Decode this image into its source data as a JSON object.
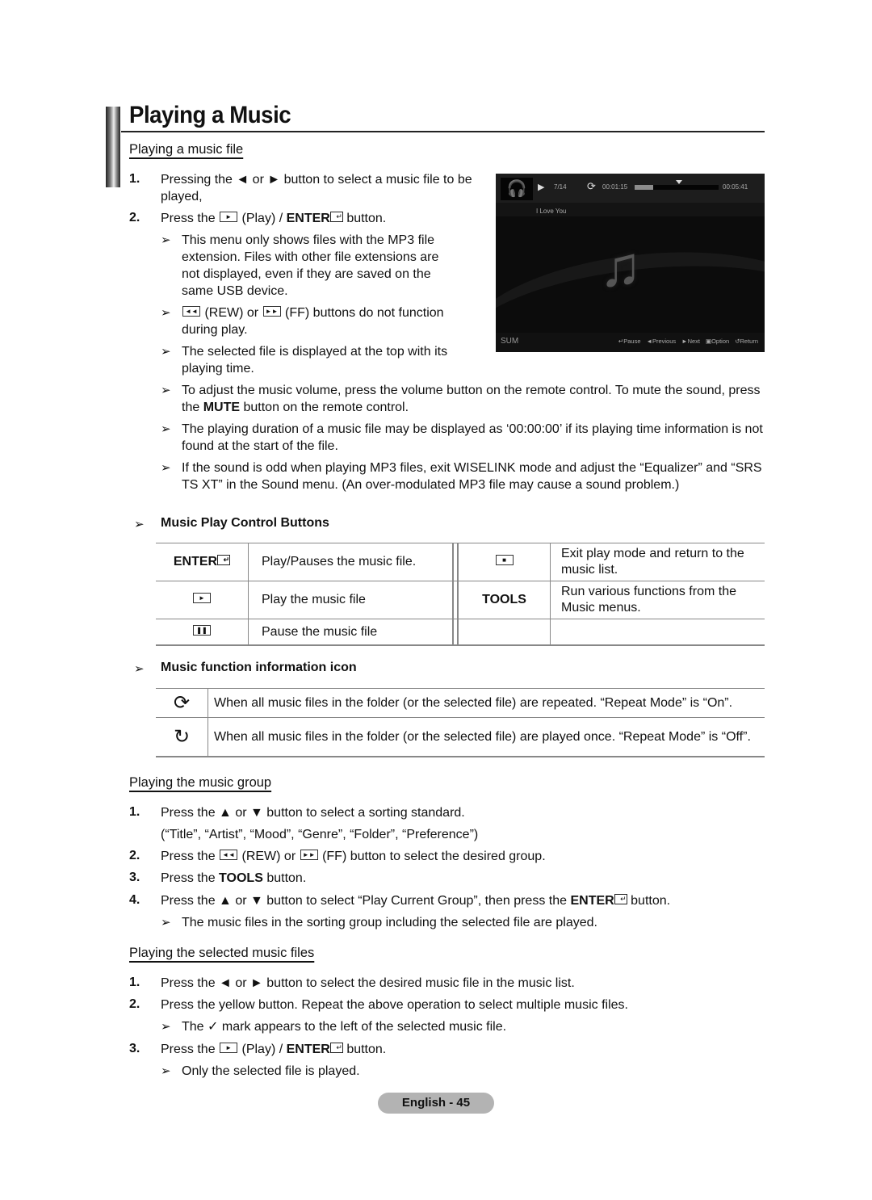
{
  "page": {
    "title": "Playing a Music",
    "footer": "English - 45"
  },
  "section1": {
    "heading": "Playing a music file",
    "steps": [
      {
        "num": "1.",
        "text": "Pressing the ◄ or ► button to select a music file to be played,"
      },
      {
        "num": "2.",
        "pre": "Press the",
        "mid": "(Play) /",
        "bold": "ENTER",
        "post": "button."
      }
    ],
    "notes": [
      "This menu only shows files with the MP3 file extension. Files with other file extensions are not displayed, even if they are saved on the same USB device.",
      {
        "mid": "(REW) or",
        "post": "(FF) buttons do not function during play."
      },
      "The selected file is displayed at the top with its playing time.",
      {
        "pre": "To adjust the music volume, press the volume button on the remote control. To mute the sound, press the",
        "bold": "MUTE",
        "post": "button on the remote control."
      },
      "The playing duration of a music file may be displayed as ‘00:00:00’ if its playing time information is not found at the start of the file.",
      "If the sound is odd when playing MP3 files, exit WISELINK mode and adjust the “Equalizer” and “SRS TS XT” in the Sound menu. (An over-modulated MP3 file may cause a sound problem.)"
    ]
  },
  "tv_screen": {
    "play_state_icon": "play-icon",
    "track_counter": "7/14",
    "repeat_icon": "repeat-icon",
    "elapsed": "00:01:15",
    "total": "00:05:41",
    "progress_fraction": 0.22,
    "song_title": "I Love You",
    "device_label": "SUM",
    "controls": [
      {
        "icon": "enter-icon",
        "glyph": "↵",
        "label": "Pause"
      },
      {
        "icon": "previous-icon",
        "glyph": "◄",
        "label": "Previous"
      },
      {
        "icon": "next-icon",
        "glyph": "►",
        "label": "Next"
      },
      {
        "icon": "option-icon",
        "glyph": "▣",
        "label": "Option"
      },
      {
        "icon": "return-icon",
        "glyph": "↺",
        "label": "Return"
      }
    ]
  },
  "control_buttons": {
    "heading": "Music Play Control Buttons",
    "rows": [
      {
        "key": "ENTER",
        "desc": "Play/Pauses the music file.",
        "key2_icon": "stop-icon",
        "key2": "■",
        "desc2": "Exit play mode and return to the music list."
      },
      {
        "key_icon": "play-icon",
        "key": "►",
        "desc": "Play the music file",
        "key2": "TOOLS",
        "desc2": "Run various functions from the Music menus."
      },
      {
        "key_icon": "pause-icon",
        "key": "❚❚",
        "desc": "Pause the music file",
        "key2": "",
        "desc2": ""
      }
    ]
  },
  "function_icons": {
    "heading": "Music function information icon",
    "rows": [
      {
        "icon": "repeat-on-icon",
        "glyph": "⟳",
        "text": "When all music files in the folder (or the selected file) are repeated. “Repeat Mode” is “On”."
      },
      {
        "icon": "repeat-off-icon",
        "glyph": "↻",
        "text": "When all music files in the folder (or the selected file) are played once. “Repeat Mode” is “Off”."
      }
    ]
  },
  "section2": {
    "heading": "Playing the music group",
    "steps": [
      {
        "num": "1.",
        "text": "Press the ▲ or ▼ button to select a sorting standard.",
        "sub": "(“Title”, “Artist”, “Mood”, “Genre”, “Folder”, “Preference”)"
      },
      {
        "num": "2.",
        "pre": "Press the",
        "mid": "(REW) or",
        "post": "(FF) button to select the desired group."
      },
      {
        "num": "3.",
        "pre": "Press the",
        "bold": "TOOLS",
        "post": "button."
      },
      {
        "num": "4.",
        "pre": "Press the ▲ or ▼ button to select “Play Current Group”, then press the",
        "bold": "ENTER",
        "post": "button."
      }
    ],
    "note": "The music files in the sorting group including the selected file are played."
  },
  "section3": {
    "heading": "Playing the selected music files",
    "steps": [
      {
        "num": "1.",
        "text": "Press the ◄ or ► button to select the desired music file in the music list."
      },
      {
        "num": "2.",
        "text": "Press the yellow button. Repeat the above operation to select multiple music files."
      },
      {
        "num": "3.",
        "pre": "Press the",
        "mid": "(Play) /",
        "bold": "ENTER",
        "post": "button."
      }
    ],
    "note_check": {
      "pre": "The",
      "glyph": "✓",
      "post": "mark appears to the left of the selected music file."
    },
    "note_final": "Only the selected file is played."
  }
}
